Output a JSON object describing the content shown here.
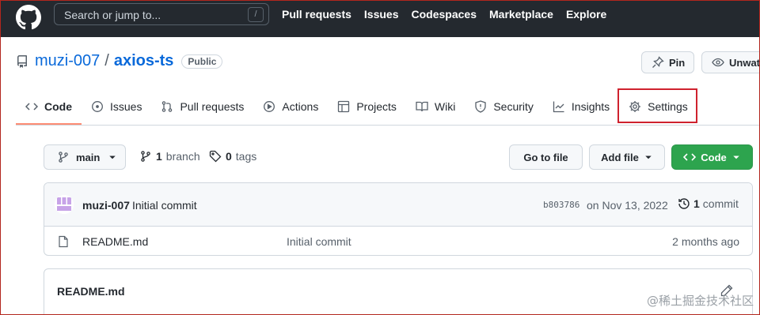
{
  "topbar": {
    "search_placeholder": "Search or jump to...",
    "search_shortcut": "/",
    "nav": [
      "Pull requests",
      "Issues",
      "Codespaces",
      "Marketplace",
      "Explore"
    ]
  },
  "repo": {
    "owner": "muzi-007",
    "separator": "/",
    "name": "axios-ts",
    "visibility": "Public",
    "pin_label": "Pin",
    "watch_label": "Unwatch"
  },
  "tabs": [
    {
      "label": "Code",
      "icon": "code-icon",
      "active": true
    },
    {
      "label": "Issues",
      "icon": "issue-icon"
    },
    {
      "label": "Pull requests",
      "icon": "pull-request-icon"
    },
    {
      "label": "Actions",
      "icon": "play-icon"
    },
    {
      "label": "Projects",
      "icon": "table-icon"
    },
    {
      "label": "Wiki",
      "icon": "book-icon"
    },
    {
      "label": "Security",
      "icon": "shield-icon"
    },
    {
      "label": "Insights",
      "icon": "graph-icon"
    },
    {
      "label": "Settings",
      "icon": "gear-icon",
      "highlighted": true
    }
  ],
  "toolbar": {
    "branch": "main",
    "branch_count": "1",
    "branch_label": "branch",
    "tag_count": "0",
    "tag_label": "tags",
    "go_to_file": "Go to file",
    "add_file": "Add file",
    "code": "Code"
  },
  "commit": {
    "author": "muzi-007",
    "message": "Initial commit",
    "hash": "b803786",
    "date": "on Nov 13, 2022",
    "count": "1",
    "count_label": "commit"
  },
  "files": [
    {
      "name": "README.md",
      "message": "Initial commit",
      "age": "2 months ago"
    }
  ],
  "readme": {
    "title": "README.md"
  },
  "watermark": "@稀土掘金技术社区",
  "colors": {
    "header_bg": "#24292f",
    "link": "#0969da",
    "code_button": "#2da44e",
    "active_tab_underline": "#fd8c73",
    "highlight_border": "#cf222e"
  }
}
